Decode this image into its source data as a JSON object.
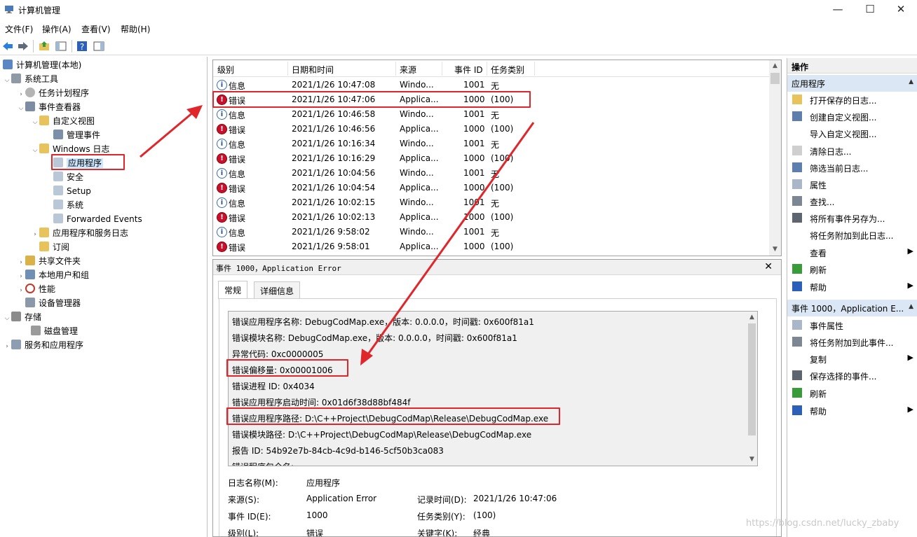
{
  "window": {
    "title": "计算机管理",
    "minimize": "—",
    "maximize": "☐",
    "close": "✕"
  },
  "menu": [
    "文件(F)",
    "操作(A)",
    "查看(V)",
    "帮助(H)"
  ],
  "tree": {
    "root": "计算机管理(本地)",
    "system_tools": "系统工具",
    "task_scheduler": "任务计划程序",
    "event_viewer": "事件查看器",
    "custom_views": "自定义视图",
    "admin_events": "管理事件",
    "windows_logs": "Windows 日志",
    "application": "应用程序",
    "security": "安全",
    "setup": "Setup",
    "system": "系统",
    "forwarded": "Forwarded Events",
    "app_service_logs": "应用程序和服务日志",
    "subscriptions": "订阅",
    "shared_folders": "共享文件夹",
    "local_users": "本地用户和组",
    "performance": "性能",
    "device_manager": "设备管理器",
    "storage": "存储",
    "disk_mgmt": "磁盘管理",
    "services_apps": "服务和应用程序"
  },
  "events": {
    "columns": [
      "级别",
      "日期和时间",
      "来源",
      "事件 ID",
      "任务类别"
    ],
    "rows": [
      {
        "level": "信息",
        "type": "info",
        "date": "2021/1/26 10:47:08",
        "source": "Windo...",
        "id": "1001",
        "cat": "无"
      },
      {
        "level": "错误",
        "type": "err",
        "date": "2021/1/26 10:47:06",
        "source": "Applica...",
        "id": "1000",
        "cat": "(100)"
      },
      {
        "level": "信息",
        "type": "info",
        "date": "2021/1/26 10:46:58",
        "source": "Windo...",
        "id": "1001",
        "cat": "无"
      },
      {
        "level": "错误",
        "type": "err",
        "date": "2021/1/26 10:46:56",
        "source": "Applica...",
        "id": "1000",
        "cat": "(100)"
      },
      {
        "level": "信息",
        "type": "info",
        "date": "2021/1/26 10:16:34",
        "source": "Windo...",
        "id": "1001",
        "cat": "无"
      },
      {
        "level": "错误",
        "type": "err",
        "date": "2021/1/26 10:16:29",
        "source": "Applica...",
        "id": "1000",
        "cat": "(100)"
      },
      {
        "level": "信息",
        "type": "info",
        "date": "2021/1/26 10:04:56",
        "source": "Windo...",
        "id": "1001",
        "cat": "无"
      },
      {
        "level": "错误",
        "type": "err",
        "date": "2021/1/26 10:04:54",
        "source": "Applica...",
        "id": "1000",
        "cat": "(100)"
      },
      {
        "level": "信息",
        "type": "info",
        "date": "2021/1/26 10:02:15",
        "source": "Windo...",
        "id": "1001",
        "cat": "无"
      },
      {
        "level": "错误",
        "type": "err",
        "date": "2021/1/26 10:02:13",
        "source": "Applica...",
        "id": "1000",
        "cat": "(100)"
      },
      {
        "level": "信息",
        "type": "info",
        "date": "2021/1/26 9:58:02",
        "source": "Windo...",
        "id": "1001",
        "cat": "无"
      },
      {
        "level": "错误",
        "type": "err",
        "date": "2021/1/26 9:58:01",
        "source": "Applica...",
        "id": "1000",
        "cat": "(100)"
      }
    ]
  },
  "detail": {
    "title": "事件 1000，Application Error",
    "close": "✕",
    "tab_general": "常规",
    "tab_details": "详细信息",
    "lines": [
      "错误应用程序名称: DebugCodMap.exe，版本: 0.0.0.0，时间戳: 0x600f81a1",
      "错误模块名称: DebugCodMap.exe，版本: 0.0.0.0，时间戳: 0x600f81a1",
      "异常代码: 0xc0000005",
      "错误偏移量: 0x00001006",
      "错误进程 ID: 0x4034",
      "错误应用程序启动时间: 0x01d6f38d88bf484f",
      "错误应用程序路径: D:\\C++Project\\DebugCodMap\\Release\\DebugCodMap.exe",
      "错误模块路径: D:\\C++Project\\DebugCodMap\\Release\\DebugCodMap.exe",
      "报告 ID: 54b92e7b-84cb-4c9d-b146-5cf50b3ca083",
      "错误程序包全名:"
    ],
    "fields": {
      "log_name_label": "日志名称(M):",
      "log_name": "应用程序",
      "source_label": "来源(S):",
      "source": "Application Error",
      "logged_label": "记录时间(D):",
      "logged": "2021/1/26 10:47:06",
      "event_id_label": "事件 ID(E):",
      "event_id": "1000",
      "task_label": "任务类别(Y):",
      "task": "(100)",
      "level_label": "级别(L):",
      "level": "错误",
      "keywords_label": "关键字(K):",
      "keywords": "经典"
    }
  },
  "actions": {
    "header": "操作",
    "section1": "应用程序",
    "items1": [
      "打开保存的日志...",
      "创建自定义视图...",
      "导入自定义视图...",
      "清除日志...",
      "筛选当前日志...",
      "属性",
      "查找...",
      "将所有事件另存为...",
      "将任务附加到此日志...",
      "查看",
      "刷新",
      "帮助"
    ],
    "section2": "事件 1000，Application E...",
    "items2": [
      "事件属性",
      "将任务附加到此事件...",
      "复制",
      "保存选择的事件...",
      "刷新",
      "帮助"
    ]
  },
  "watermark": "https://blog.csdn.net/lucky_zbaby",
  "colors": {
    "annotation": "#e0262a",
    "selection": "#cce8ff",
    "section": "#dbe7f5"
  }
}
